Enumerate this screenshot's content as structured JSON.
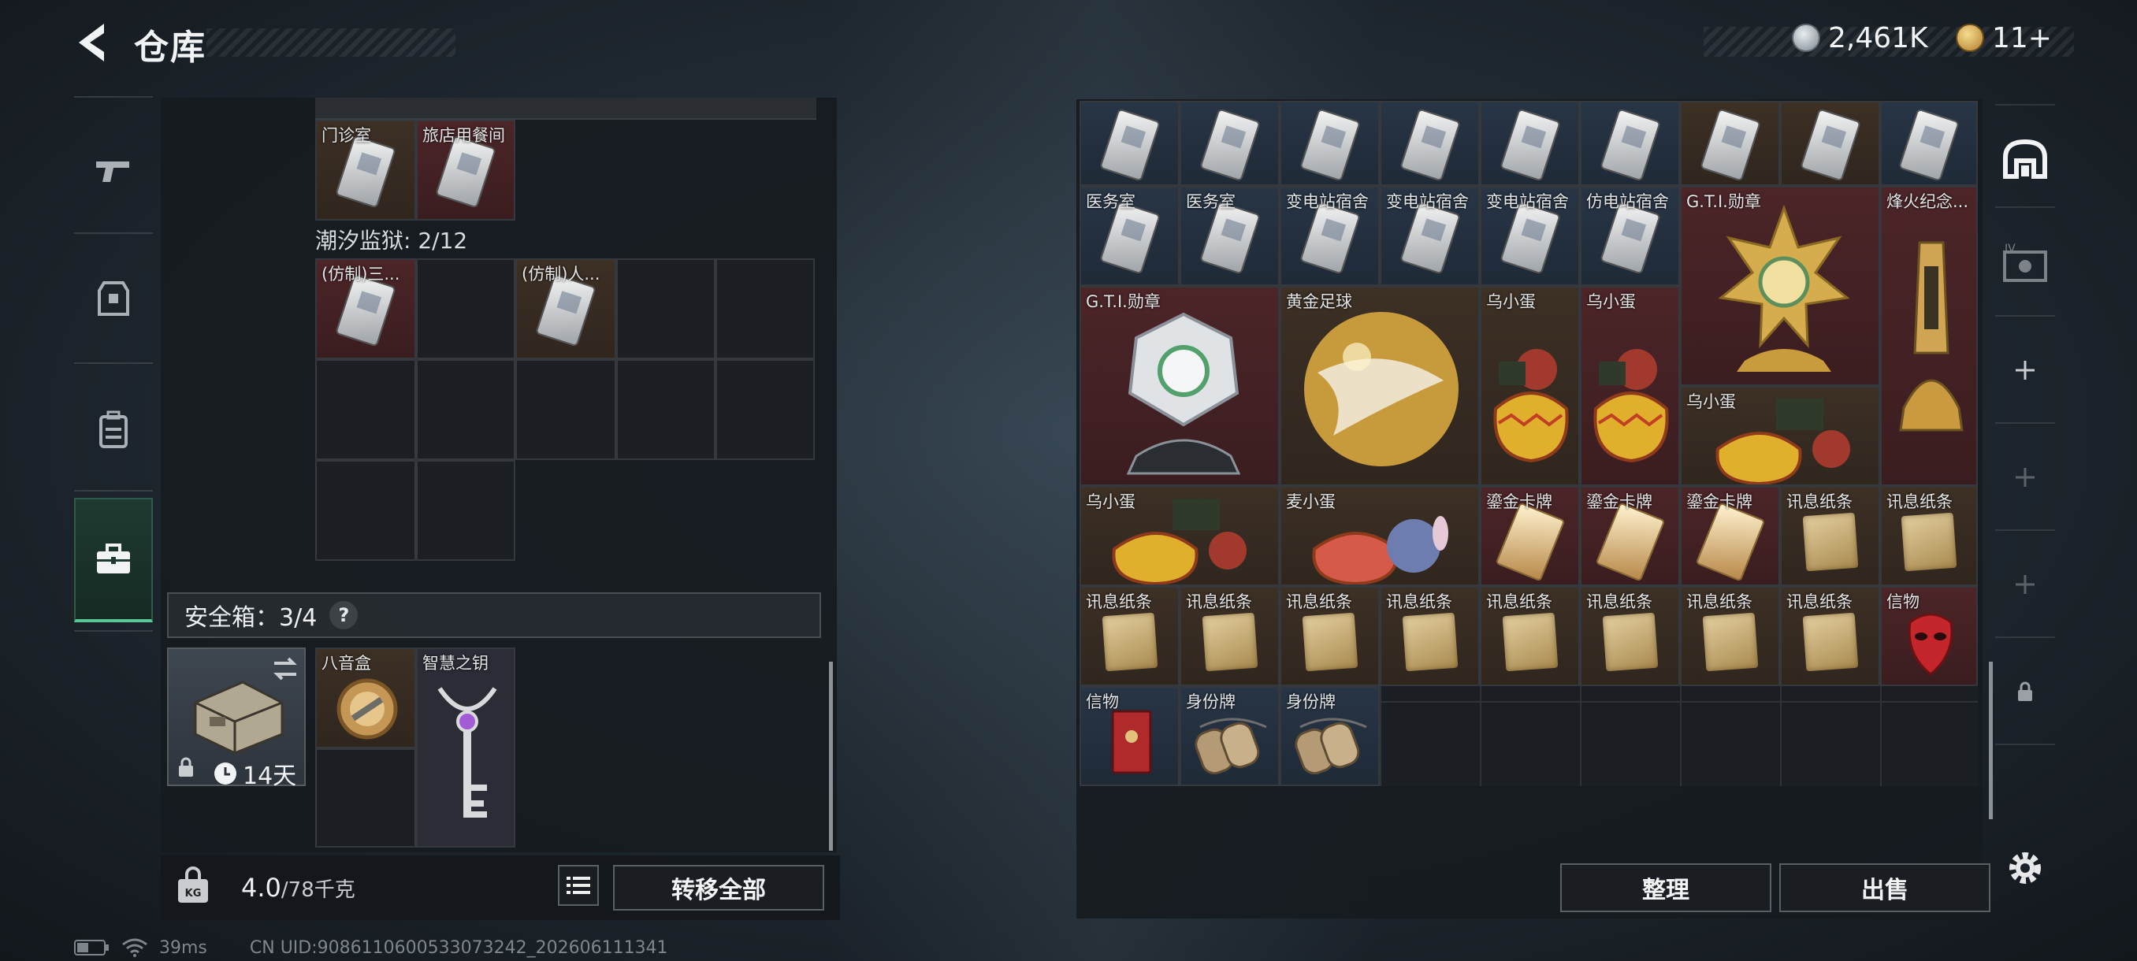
{
  "header": {
    "title": "仓库",
    "currency_silver": "2,461K",
    "currency_gold": "11+"
  },
  "left_nav": {
    "items": [
      {
        "icon": "gun-icon"
      },
      {
        "icon": "armor-icon"
      },
      {
        "icon": "backpack-icon"
      },
      {
        "icon": "toolbox-icon",
        "active": true
      }
    ]
  },
  "left_panel": {
    "row1_labels": [
      "门诊室",
      "旅店用餐间"
    ],
    "section_title": "潮汐监狱: 2/12",
    "section_items": [
      "(仿制)三...",
      "(仿制)人..."
    ],
    "safe_box": {
      "title": "安全箱：3/4",
      "help": "?",
      "timer": "14天",
      "items": [
        "八音盒",
        "智慧之钥"
      ]
    },
    "weight_value": "4.0",
    "weight_max": "/78千克",
    "transfer_all": "转移全部"
  },
  "right_panel": {
    "row2_labels": [
      "医务室",
      "医务室",
      "变电站宿舍",
      "变电站宿舍",
      "变电站宿舍",
      "仿电站宿舍"
    ],
    "large_items": [
      "G.T.I.勋章",
      "G.T.I.勋章",
      "烽火纪念...",
      "黄金足球"
    ],
    "eggs": [
      "乌小蛋",
      "乌小蛋",
      "乌小蛋",
      "乌小蛋",
      "麦小蛋"
    ],
    "gold_cards": [
      "鎏金卡牌",
      "鎏金卡牌",
      "鎏金卡牌"
    ],
    "paper_row4": [
      "讯息纸条",
      "讯息纸条"
    ],
    "paper_row5": [
      "讯息纸条",
      "讯息纸条",
      "讯息纸条",
      "讯息纸条",
      "讯息纸条",
      "讯息纸条",
      "讯息纸条",
      "讯息纸条"
    ],
    "keepsake": "信物",
    "row6": [
      "信物",
      "身份牌",
      "身份牌"
    ],
    "organize": "整理",
    "sell": "出售"
  },
  "status_bar": {
    "ping": "39ms",
    "uid": "CN UID:9086110600533073242_202606111341"
  },
  "colors": {
    "accent_green": "#59c69a",
    "slot_red": "#4c2528",
    "slot_brown": "#3d3025",
    "slot_blue": "#283545"
  }
}
